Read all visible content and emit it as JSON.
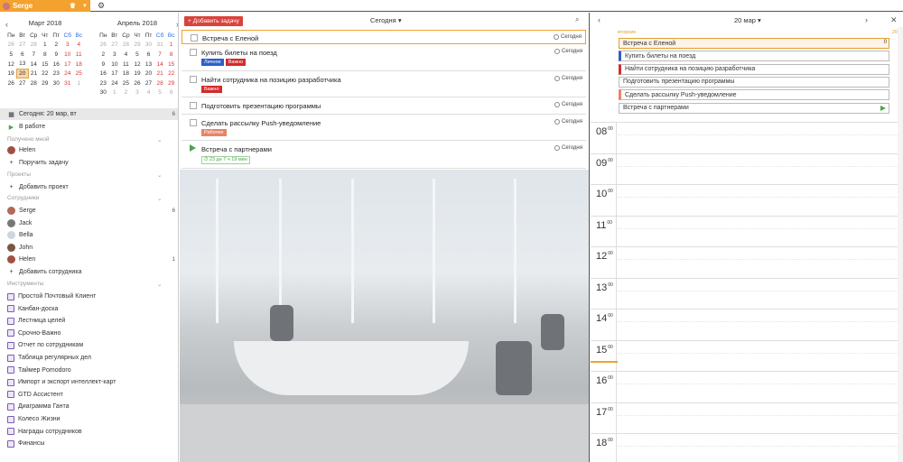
{
  "topbar": {
    "user": "Serge",
    "settings_icon": "gear-icon"
  },
  "calendars": [
    {
      "title": "Март 2018",
      "weekdays": [
        "Пн",
        "Вт",
        "Ср",
        "Чт",
        "Пт",
        "Сб",
        "Вс"
      ],
      "weeks": [
        [
          "26",
          "27",
          "28",
          "1",
          "2",
          "3",
          "4"
        ],
        [
          "5",
          "6",
          "7",
          "8",
          "9",
          "10",
          "11"
        ],
        [
          "12",
          "13",
          "14",
          "15",
          "16",
          "17",
          "18"
        ],
        [
          "19",
          "20",
          "21",
          "22",
          "23",
          "24",
          "25"
        ],
        [
          "26",
          "27",
          "28",
          "29",
          "30",
          "31",
          "1"
        ]
      ],
      "muted_prefix": 3,
      "muted_suffix": 1,
      "today": "20"
    },
    {
      "title": "Апрель 2018",
      "weekdays": [
        "Пн",
        "Вт",
        "Ср",
        "Чт",
        "Пт",
        "Сб",
        "Вс"
      ],
      "weeks": [
        [
          "26",
          "27",
          "28",
          "29",
          "30",
          "31",
          "1"
        ],
        [
          "2",
          "3",
          "4",
          "5",
          "6",
          "7",
          "8"
        ],
        [
          "9",
          "10",
          "11",
          "12",
          "13",
          "14",
          "15"
        ],
        [
          "16",
          "17",
          "18",
          "19",
          "20",
          "21",
          "22"
        ],
        [
          "23",
          "24",
          "25",
          "26",
          "27",
          "28",
          "29"
        ],
        [
          "30",
          "1",
          "2",
          "3",
          "4",
          "5",
          "6"
        ]
      ],
      "muted_prefix": 6,
      "muted_suffix": 6,
      "today": ""
    }
  ],
  "sidebar": {
    "today": {
      "label": "Сегодня: 20 мар, вт",
      "count": "6"
    },
    "in_work": "В работе",
    "received_section": "Получено мной",
    "received_items": [
      {
        "name": "Helen"
      }
    ],
    "assign_task": "Поручить задачу",
    "projects_section": "Проекты",
    "add_project": "Добавить проект",
    "staff_section": "Сотрудники",
    "staff": [
      {
        "name": "Serge",
        "count": "6",
        "color": "#b06a55"
      },
      {
        "name": "Jack",
        "count": "",
        "color": "#777777"
      },
      {
        "name": "Bella",
        "count": "",
        "color": "#cfd6dd"
      },
      {
        "name": "John",
        "count": "",
        "color": "#7a5540"
      },
      {
        "name": "Helen",
        "count": "1",
        "color": "#a05040"
      }
    ],
    "add_staff": "Добавить сотрудника",
    "tools_section": "Инструменты",
    "tools": [
      "Простой Почтовый Клиент",
      "Канбан-доска",
      "Лестница целей",
      "Срочно-Важно",
      "Отчет по сотрудникам",
      "Таблица регулярных дел",
      "Таймер Pomodoro",
      "Импорт и экспорт интеллект-карт",
      "GTD Ассистент",
      "Диаграмма Ганта",
      "Колесо Жизни",
      "Награды сотрудников",
      "Финансы"
    ]
  },
  "main": {
    "add_task": "Добавить задачу",
    "filter": "Сегодня",
    "tasks": [
      {
        "title": "Встреча с Еленой",
        "due": "Сегодня",
        "tags": [],
        "timer": ""
      },
      {
        "title": "Купить билеты на поезд",
        "due": "Сегодня",
        "tags": [
          {
            "label": "Личное",
            "color": "#2f5fc8"
          },
          {
            "label": "Важно",
            "color": "#d32b2b"
          }
        ],
        "timer": ""
      },
      {
        "title": "Найти сотрудника на позицию разработчика",
        "due": "Сегодня",
        "tags": [
          {
            "label": "Важно",
            "color": "#d32b2b"
          }
        ],
        "timer": ""
      },
      {
        "title": "Подготовить презентацию программы",
        "due": "Сегодня",
        "tags": [],
        "timer": ""
      },
      {
        "title": "Сделать рассылку Push-уведомление",
        "due": "Сегодня",
        "tags": [
          {
            "label": "Рабочее",
            "color": "#e8836a"
          }
        ],
        "timer": ""
      },
      {
        "title": "Встреча с партнерами",
        "due": "Сегодня",
        "tags": [],
        "timer": "23 дн 7 ч 19 мин"
      }
    ]
  },
  "agenda": {
    "date": "20 мар",
    "weekday": "вторник",
    "day_number": "20",
    "events": [
      {
        "title": "Встреча с Еленой",
        "color": "#e0a030"
      },
      {
        "title": "Купить билеты на поезд",
        "color": "#2f5fc8"
      },
      {
        "title": "Найти сотрудника на позицию разработчика",
        "color": "#d32b2b"
      },
      {
        "title": "Подготовить презентацию программы",
        "color": ""
      },
      {
        "title": "Сделать рассылку  Push-уведомление",
        "color": "#e8836a"
      },
      {
        "title": "Встреча с партнерами",
        "color": ""
      }
    ],
    "first_event_count": "0",
    "hours": [
      "08",
      "09",
      "10",
      "11",
      "12",
      "13",
      "14",
      "15",
      "16",
      "17",
      "18"
    ],
    "minutes": "00"
  }
}
